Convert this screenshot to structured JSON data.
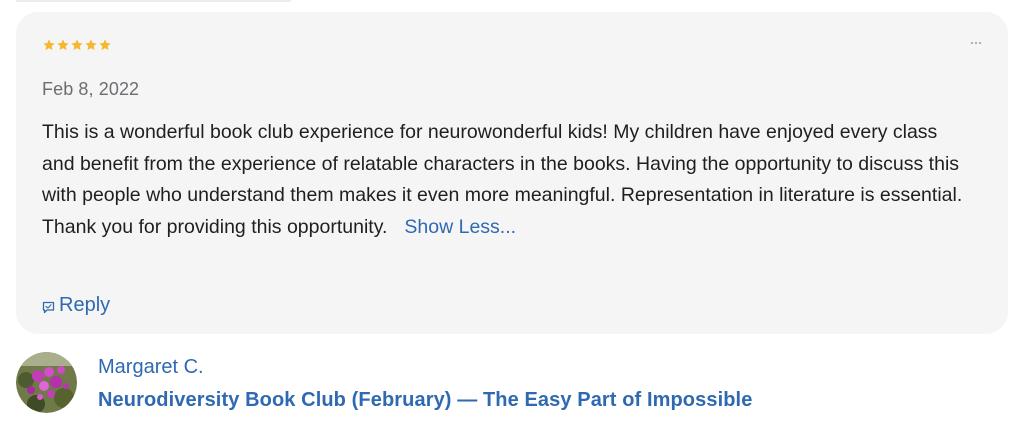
{
  "review": {
    "rating": 5,
    "rating_max": 5,
    "star_color": "#f5b82e",
    "more_icon": "ellipsis-icon",
    "date": "Feb 8, 2022",
    "text": "This is a wonderful book club experience for neurowonderful kids! My children have enjoyed every class and benefit from the experience of relatable characters in the books. Having the opportunity to discuss this with people who understand them makes it even more meaningful. Representation in literature is essential. Thank you for providing this opportunity.",
    "show_less_label": "Show Less...",
    "reply_label": "Reply",
    "reply_icon": "speech-bubble-icon"
  },
  "author": {
    "name": "Margaret C.",
    "avatar_icon": "flower-photo-avatar",
    "event_title": "Neurodiversity Book Club (February) — The Easy Part of Impossible"
  },
  "colors": {
    "link": "#2f6ab1",
    "card_background": "#f5f5f6",
    "body_text": "#1f1f22",
    "muted_text": "#6d6d72"
  }
}
